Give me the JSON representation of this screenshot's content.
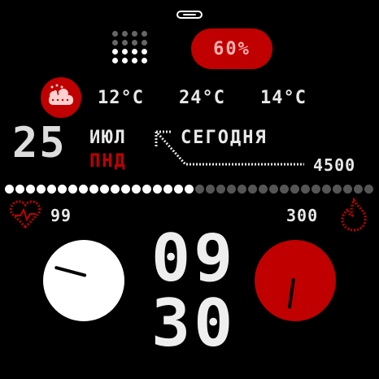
{
  "battery": {
    "level": "60%"
  },
  "weather": {
    "icon": "cloudy-weather-icon",
    "temps": [
      "12°C",
      "24°C",
      "14°C"
    ]
  },
  "date": {
    "day": "25",
    "month": "ИЮЛ",
    "weekday": "ПНД",
    "today_label": "СЕГОДНЯ"
  },
  "steps": {
    "goal": "4500",
    "progress_fraction": 0.5
  },
  "health": {
    "heart_rate": "99",
    "calories": "300"
  },
  "time": {
    "hour": "09",
    "minute": "30"
  },
  "colors": {
    "accent": "#c00000",
    "text": "#e8e8e8",
    "dim": "#555555",
    "background": "#000000"
  }
}
